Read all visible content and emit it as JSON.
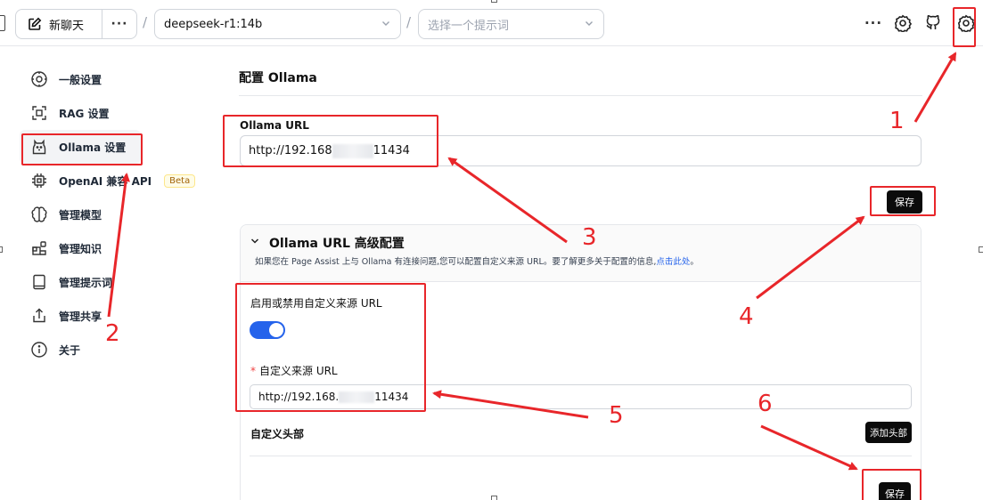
{
  "topbar": {
    "new_chat_label": "新聊天",
    "more_label": "···",
    "model_value": "deepseek-r1:14b",
    "prompt_placeholder": "选择一个提示词",
    "top_more_label": "···"
  },
  "sidebar": {
    "items": [
      {
        "label": "一般设置",
        "icon": "general-settings-icon"
      },
      {
        "label": "RAG 设置",
        "icon": "rag-icon"
      },
      {
        "label": "Ollama 设置",
        "icon": "ollama-icon",
        "active": true
      },
      {
        "label": "OpenAI 兼容 API",
        "icon": "chip-icon",
        "badge": "Beta"
      },
      {
        "label": "管理模型",
        "icon": "brain-icon"
      },
      {
        "label": "管理知识",
        "icon": "blocks-icon"
      },
      {
        "label": "管理提示词",
        "icon": "book-icon"
      },
      {
        "label": "管理共享",
        "icon": "share-icon"
      },
      {
        "label": "关于",
        "icon": "info-icon"
      }
    ]
  },
  "main": {
    "section_title": "配置 Ollama",
    "url_label": "Ollama URL",
    "url_value_prefix": "http://192.168",
    "url_value_suffix": "11434",
    "save_label": "保存",
    "advanced": {
      "title": "Ollama URL 高级配置",
      "description": "如果您在 Page Assist 上与 Ollama 有连接问题,您可以配置自定义来源 URL。要了解更多关于配置的信息,",
      "link_text": "点击此处",
      "description_end": "。",
      "toggle_label": "启用或禁用自定义来源 URL",
      "toggle_on": true,
      "custom_origin_label": "自定义来源 URL",
      "required_mark": "*",
      "custom_origin_prefix": "http://192.168.",
      "custom_origin_suffix": "11434",
      "headers_label": "自定义头部",
      "add_header_label": "添加头部",
      "save_label": "保存"
    }
  },
  "annotations": {
    "numbers": [
      "1",
      "2",
      "3",
      "4",
      "5",
      "6"
    ],
    "color": "#e8262a"
  },
  "colors": {
    "accent": "#2563eb",
    "button_bg": "#0b0b0b",
    "annotation_red": "#e8262a"
  }
}
